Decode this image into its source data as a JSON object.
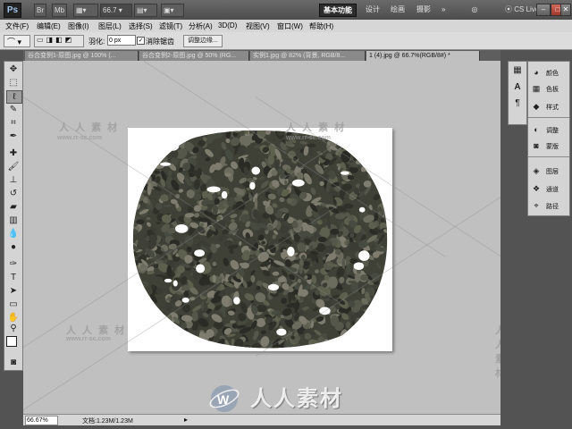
{
  "app": {
    "logo": "Ps",
    "bridge_label": "Br",
    "minibridge_label": "Mb",
    "zoom_value": "66.7",
    "workspaces": [
      "基本功能",
      "设计",
      "绘画",
      "摄影"
    ],
    "more_label": "»",
    "cs_live": "CS Live",
    "window_controls": [
      "–",
      "□",
      "✕"
    ]
  },
  "menu": [
    "文件(F)",
    "编辑(E)",
    "图像(I)",
    "图层(L)",
    "选择(S)",
    "滤镜(T)",
    "分析(A)",
    "3D(D)",
    "视图(V)",
    "窗口(W)",
    "帮助(H)"
  ],
  "options": {
    "feather_label": "羽化:",
    "feather_value": "0 px",
    "antialias_label": "消除锯齿",
    "refine_label": "调整边缘..."
  },
  "tabs": [
    {
      "label": "谷合变例1-原图.jpg @ 100% (...",
      "active": false
    },
    {
      "label": "谷合变例2-原图.jpg @ 50% (RG...",
      "active": false
    },
    {
      "label": "实例1.jpg @ 82% (背景, RGB/8...",
      "active": false
    },
    {
      "label": "1 (4).jpg @ 66.7%(RGB/8#) *",
      "active": true
    }
  ],
  "tools": [
    "move-icon",
    "marquee-icon",
    "lasso-icon",
    "quick-select-icon",
    "crop-icon",
    "eyedropper-icon",
    "healing-icon",
    "brush-icon",
    "stamp-icon",
    "history-brush-icon",
    "eraser-icon",
    "gradient-icon",
    "blur-icon",
    "dodge-icon",
    "pen-icon",
    "type-icon",
    "path-select-icon",
    "shape-icon",
    "hand-icon",
    "zoom-icon"
  ],
  "panels": [
    {
      "icon": "color-icon",
      "label": "颜色"
    },
    {
      "icon": "swatches-icon",
      "label": "色板"
    },
    {
      "icon": "styles-icon",
      "label": "样式"
    },
    {
      "icon": "adjustments-icon",
      "label": "调整"
    },
    {
      "icon": "masks-icon",
      "label": "蒙版"
    },
    {
      "icon": "layers-icon",
      "label": "图层"
    },
    {
      "icon": "channels-icon",
      "label": "通道"
    },
    {
      "icon": "paths-icon",
      "label": "路径"
    }
  ],
  "status": {
    "zoom": "66.67%",
    "doc_info": "文档:1.23M/1.23M"
  },
  "watermark": {
    "url_top": "www.rr-sc.com",
    "brand": "人人素材",
    "corner_brand": "人 人 素 材",
    "corner_url": "www.rr-sc.com"
  },
  "colors": {
    "canvas_bg": "#c0c0c0",
    "chrome_dark": "#535353",
    "accent": "#2c2c2c"
  }
}
